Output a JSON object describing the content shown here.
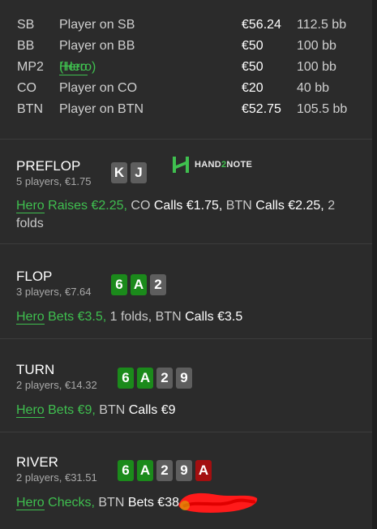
{
  "seats": [
    {
      "pos": "SB",
      "name": "Player on SB",
      "stack": "€56.24",
      "bb": "112.5 bb",
      "is_hero": false
    },
    {
      "pos": "BB",
      "name": "Player on BB",
      "stack": "€50",
      "bb": "100 bb",
      "is_hero": false
    },
    {
      "pos": "MP2",
      "name": "Hero (Hero)",
      "name_underlined": "Hero",
      "name_rest": " (Hero)",
      "stack": "€50",
      "bb": "100 bb",
      "is_hero": true
    },
    {
      "pos": "CO",
      "name": "Player on CO",
      "stack": "€20",
      "bb": "40 bb",
      "is_hero": false
    },
    {
      "pos": "BTN",
      "name": "Player on BTN",
      "stack": "€52.75",
      "bb": "105.5 bb",
      "is_hero": false
    }
  ],
  "logo": {
    "prefix": "HAND",
    "two": "2",
    "suffix": "NOTE"
  },
  "streets": [
    {
      "title": "PREFLOP",
      "subtitle": "5 players, €1.75",
      "cards": [
        {
          "rank": "K",
          "color": "grey"
        },
        {
          "rank": "J",
          "color": "grey"
        }
      ],
      "action": {
        "hero": "Hero",
        "hero_rest": " Raises €2.25,",
        "p1": " CO",
        "v1": " Calls €1.75,",
        "p2": " BTN",
        "v2": " Calls €2.25,",
        "tail": " 2",
        "tail2": "folds"
      }
    },
    {
      "title": "FLOP",
      "subtitle": "3 players, €7.64",
      "cards": [
        {
          "rank": "6",
          "color": "green"
        },
        {
          "rank": "A",
          "color": "green"
        },
        {
          "rank": "2",
          "color": "grey"
        }
      ],
      "action": {
        "hero": "Hero",
        "hero_rest": " Bets €3.5,",
        "p1": " 1 folds,",
        "p2": " BTN",
        "v2": " Calls €3.5"
      }
    },
    {
      "title": "TURN",
      "subtitle": "2 players, €14.32",
      "cards": [
        {
          "rank": "6",
          "color": "green"
        },
        {
          "rank": "A",
          "color": "green"
        },
        {
          "rank": "2",
          "color": "grey"
        },
        {
          "rank": "9",
          "color": "grey"
        }
      ],
      "action": {
        "hero": "Hero",
        "hero_rest": " Bets €9,",
        "p2": " BTN",
        "v2": " Calls €9"
      }
    },
    {
      "title": "RIVER",
      "subtitle": "2 players, €31.51",
      "cards": [
        {
          "rank": "6",
          "color": "green"
        },
        {
          "rank": "A",
          "color": "green"
        },
        {
          "rank": "2",
          "color": "grey"
        },
        {
          "rank": "9",
          "color": "grey"
        },
        {
          "rank": "A",
          "color": "red"
        }
      ],
      "action": {
        "hero": "Hero",
        "hero_rest": " Checks,",
        "p2": " BTN",
        "v2": " Bets €38,"
      }
    }
  ],
  "colors": {
    "background": "#2b2b2b",
    "hero_green": "#3fbf4f",
    "card_green": "#1b8a1b",
    "card_grey": "#5e5e5e",
    "card_red": "#a30f10",
    "redaction": "#ff1a1a"
  }
}
